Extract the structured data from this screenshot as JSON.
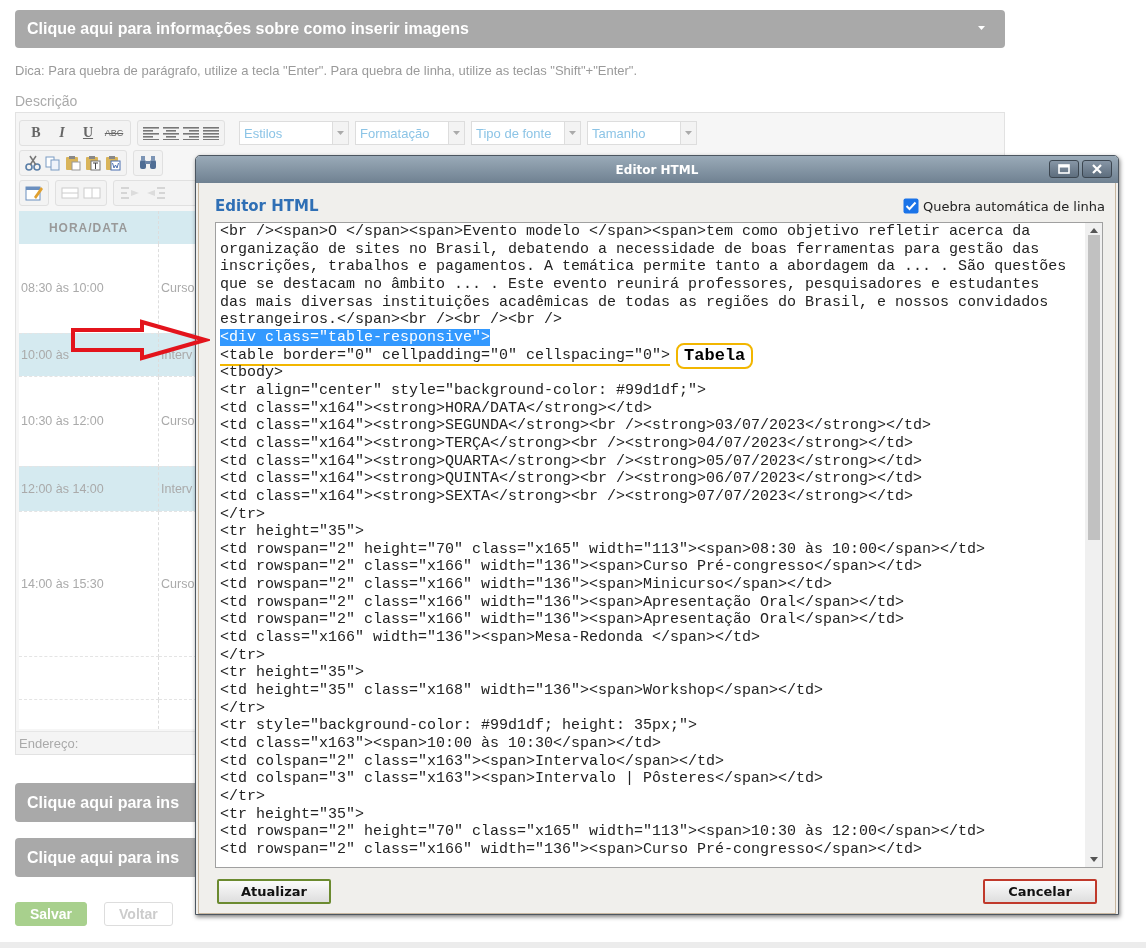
{
  "info_bar": {
    "label": "Clique aqui para informações sobre como inserir imagens"
  },
  "hint": "Dica: Para quebra de parágrafo, utilize a tecla \"Enter\". Para quebra de linha, utilize as teclas \"Shift\"+\"Enter\".",
  "description_label": "Descrição",
  "editor": {
    "format_buttons": [
      {
        "label": "B",
        "kind": "bold"
      },
      {
        "label": "I",
        "kind": "italic"
      },
      {
        "label": "U",
        "kind": "underline"
      },
      {
        "label": "ABC",
        "kind": "strike"
      }
    ],
    "dropdowns": [
      {
        "placeholder": "Estilos"
      },
      {
        "placeholder": "Formatação"
      },
      {
        "placeholder": "Tipo de fonte"
      },
      {
        "placeholder": "Tamanho"
      }
    ],
    "table": {
      "header": "HORA/DATA",
      "rows": [
        {
          "time": "08:30 às 10:00",
          "activity": "Curso",
          "highlighted": false
        },
        {
          "time": "10:00 às",
          "activity": "Interv",
          "highlighted": true
        },
        {
          "time": "10:30 às 12:00",
          "activity": "Curso",
          "highlighted": false
        },
        {
          "time": "12:00 às 14:00",
          "activity": "Interv",
          "highlighted": true
        },
        {
          "time": "14:00 às 15:30",
          "activity": "Curso",
          "highlighted": false
        }
      ]
    },
    "status_label": "Endereço:"
  },
  "collapsed_bars": [
    {
      "label": "Clique aqui para ins"
    },
    {
      "label": "Clique aqui para ins"
    }
  ],
  "buttons": [
    {
      "label": "Salvar",
      "kind": "primary"
    },
    {
      "label": "Voltar",
      "kind": "secondary"
    }
  ],
  "dialog": {
    "title": "Editor HTML",
    "heading": "Editor HTML",
    "wrap_option": {
      "label": "Quebra automática de linha",
      "checked": true
    },
    "code_lines": [
      {
        "text": "<br /><span>O </span><span>Evento modelo </span><span>tem como objetivo refletir acerca da",
        "selected": false,
        "underlined": false
      },
      {
        "text": "organização de sites no Brasil, debatendo a necessidade de boas ferramentas para gestão das",
        "selected": false,
        "underlined": false
      },
      {
        "text": "inscrições, trabalhos e pagamentos. A temática permite tanto a abordagem da ... . São questões",
        "selected": false,
        "underlined": false
      },
      {
        "text": "que se destacam no âmbito ... . Este evento reunirá professores, pesquisadores e estudantes",
        "selected": false,
        "underlined": false
      },
      {
        "text": "das mais diversas instituições acadêmicas de todas as regiões do Brasil, e nossos convidados",
        "selected": false,
        "underlined": false
      },
      {
        "text": "estrangeiros.</span><br /><br /><br />",
        "selected": false,
        "underlined": false
      },
      {
        "text": "<div class=\"table-responsive\">",
        "selected": true,
        "underlined": false
      },
      {
        "text": "<table border=\"0\" cellpadding=\"0\" cellspacing=\"0\">",
        "selected": false,
        "underlined": true
      },
      {
        "text": "<tbody>",
        "selected": false,
        "underlined": false
      },
      {
        "text": "<tr align=\"center\" style=\"background-color: #99d1df;\">",
        "selected": false,
        "underlined": false
      },
      {
        "text": "<td class=\"x164\"><strong>HORA/DATA</strong></td>",
        "selected": false,
        "underlined": false
      },
      {
        "text": "<td class=\"x164\"><strong>SEGUNDA</strong><br /><strong>03/07/2023</strong></td>",
        "selected": false,
        "underlined": false
      },
      {
        "text": "<td class=\"x164\"><strong>TERÇA</strong><br /><strong>04/07/2023</strong></td>",
        "selected": false,
        "underlined": false
      },
      {
        "text": "<td class=\"x164\"><strong>QUARTA</strong><br /><strong>05/07/2023</strong></td>",
        "selected": false,
        "underlined": false
      },
      {
        "text": "<td class=\"x164\"><strong>QUINTA</strong><br /><strong>06/07/2023</strong></td>",
        "selected": false,
        "underlined": false
      },
      {
        "text": "<td class=\"x164\"><strong>SEXTA</strong><br /><strong>07/07/2023</strong></td>",
        "selected": false,
        "underlined": false
      },
      {
        "text": "</tr>",
        "selected": false,
        "underlined": false
      },
      {
        "text": "<tr height=\"35\">",
        "selected": false,
        "underlined": false
      },
      {
        "text": "<td rowspan=\"2\" height=\"70\" class=\"x165\" width=\"113\"><span>08:30 às 10:00</span></td>",
        "selected": false,
        "underlined": false
      },
      {
        "text": "<td rowspan=\"2\" class=\"x166\" width=\"136\"><span>Curso Pré-congresso</span></td>",
        "selected": false,
        "underlined": false
      },
      {
        "text": "<td rowspan=\"2\" class=\"x166\" width=\"136\"><span>Minicurso</span></td>",
        "selected": false,
        "underlined": false
      },
      {
        "text": "<td rowspan=\"2\" class=\"x166\" width=\"136\"><span>Apresentação Oral</span></td>",
        "selected": false,
        "underlined": false
      },
      {
        "text": "<td rowspan=\"2\" class=\"x166\" width=\"136\"><span>Apresentação Oral</span></td>",
        "selected": false,
        "underlined": false
      },
      {
        "text": "<td class=\"x166\" width=\"136\"><span>Mesa-Redonda </span></td>",
        "selected": false,
        "underlined": false
      },
      {
        "text": "</tr>",
        "selected": false,
        "underlined": false
      },
      {
        "text": "<tr height=\"35\">",
        "selected": false,
        "underlined": false
      },
      {
        "text": "<td height=\"35\" class=\"x168\" width=\"136\"><span>Workshop</span></td>",
        "selected": false,
        "underlined": false
      },
      {
        "text": "</tr>",
        "selected": false,
        "underlined": false
      },
      {
        "text": "<tr style=\"background-color: #99d1df; height: 35px;\">",
        "selected": false,
        "underlined": false
      },
      {
        "text": "<td class=\"x163\"><span>10:00 às 10:30</span></td>",
        "selected": false,
        "underlined": false
      },
      {
        "text": "<td colspan=\"2\" class=\"x163\"><span>Intervalo</span></td>",
        "selected": false,
        "underlined": false
      },
      {
        "text": "<td colspan=\"3\" class=\"x163\"><span>Intervalo | Pôsteres</span></td>",
        "selected": false,
        "underlined": false
      },
      {
        "text": "</tr>",
        "selected": false,
        "underlined": false
      },
      {
        "text": "<tr height=\"35\">",
        "selected": false,
        "underlined": false
      },
      {
        "text": "<td rowspan=\"2\" height=\"70\" class=\"x165\" width=\"113\"><span>10:30 às 12:00</span></td>",
        "selected": false,
        "underlined": false
      },
      {
        "text": "<td rowspan=\"2\" class=\"x166\" width=\"136\"><span>Curso Pré-congresso</span></td>",
        "selected": false,
        "underlined": false
      }
    ],
    "buttons": [
      {
        "label": "Atualizar",
        "kind": "update"
      },
      {
        "label": "Cancelar",
        "kind": "cancel"
      }
    ]
  },
  "annotation": {
    "label": "Tabela"
  }
}
